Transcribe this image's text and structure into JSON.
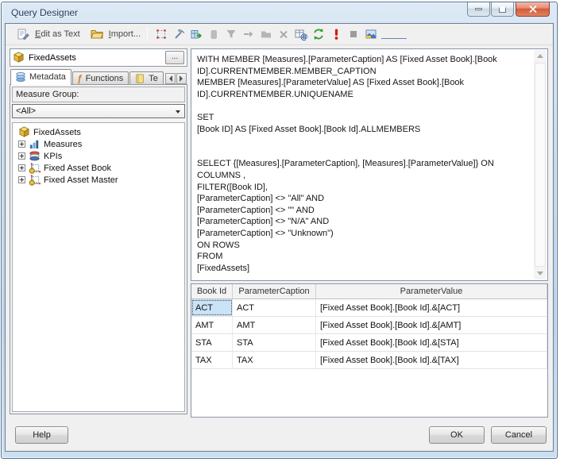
{
  "window": {
    "title": "Query Designer",
    "caption_buttons": [
      "minimize",
      "maximize",
      "close"
    ]
  },
  "toolbar": {
    "edit_as_text_label": "Edit as Text",
    "import_label": "Import...",
    "icons": [
      "edit-as-text-icon",
      "import-folder-icon",
      "select-mode-icon",
      "pickaxe-icon",
      "show-empty-cells-icon",
      "calculated-member-icon",
      "filter-icon",
      "autoexecute-icon",
      "group-icon",
      "delete-icon",
      "query-parameters-icon",
      "refresh-icon",
      "execute-icon",
      "cancel-execute-icon",
      "design-mode-icon"
    ],
    "accent_green": "#2e9e2e",
    "accent_red": "#cc2200"
  },
  "cube_selector": {
    "name": "FixedAssets",
    "browse_label": "..."
  },
  "tabs": [
    {
      "label": "Metadata",
      "icon": "metadata-layers-icon",
      "active": true
    },
    {
      "label": "Functions",
      "icon": "function-icon",
      "active": false
    },
    {
      "label": "Te",
      "icon": "templates-book-icon",
      "active": false
    }
  ],
  "measure_group": {
    "label": "Measure Group:",
    "value": "<All>"
  },
  "tree": {
    "root_label": "FixedAssets",
    "root_icon": "cube-icon",
    "items": [
      {
        "label": "Measures",
        "icon": "measures-icon",
        "expandable": true
      },
      {
        "label": "KPIs",
        "icon": "kpi-icon",
        "expandable": true
      },
      {
        "label": "Fixed Asset Book",
        "icon": "dimension-icon",
        "expandable": true
      },
      {
        "label": "Fixed Asset Master",
        "icon": "dimension-icon",
        "expandable": true
      }
    ]
  },
  "query": {
    "text": "WITH MEMBER [Measures].[ParameterCaption] AS [Fixed Asset Book].[Book\nID].CURRENTMEMBER.MEMBER_CAPTION\nMEMBER [Measures].[ParameterValue] AS [Fixed Asset Book].[Book\nID].CURRENTMEMBER.UNIQUENAME\n\nSET\n[Book ID] AS [Fixed Asset Book].[Book Id].ALLMEMBERS\n\n\nSELECT {[Measures].[ParameterCaption], [Measures].[ParameterValue]} ON COLUMNS ,\nFILTER([Book ID],\n[ParameterCaption] <> \"All\" AND\n[ParameterCaption] <> \"\" AND\n[ParameterCaption] <> \"N/A\" AND\n[ParameterCaption] <> \"Unknown\")\nON ROWS\nFROM\n[FixedAssets]"
  },
  "grid": {
    "columns": [
      "Book Id",
      "ParameterCaption",
      "ParameterValue"
    ],
    "rows": [
      [
        "ACT",
        "ACT",
        "[Fixed Asset Book].[Book Id].&[ACT]"
      ],
      [
        "AMT",
        "AMT",
        "[Fixed Asset Book].[Book Id].&[AMT]"
      ],
      [
        "STA",
        "STA",
        "[Fixed Asset Book].[Book Id].&[STA]"
      ],
      [
        "TAX",
        "TAX",
        "[Fixed Asset Book].[Book Id].&[TAX]"
      ]
    ],
    "selected_cell": "row 0, col 0",
    "selection_color": "#cbe3f7"
  },
  "footer": {
    "help_label": "Help",
    "ok_label": "OK",
    "cancel_label": "Cancel"
  }
}
